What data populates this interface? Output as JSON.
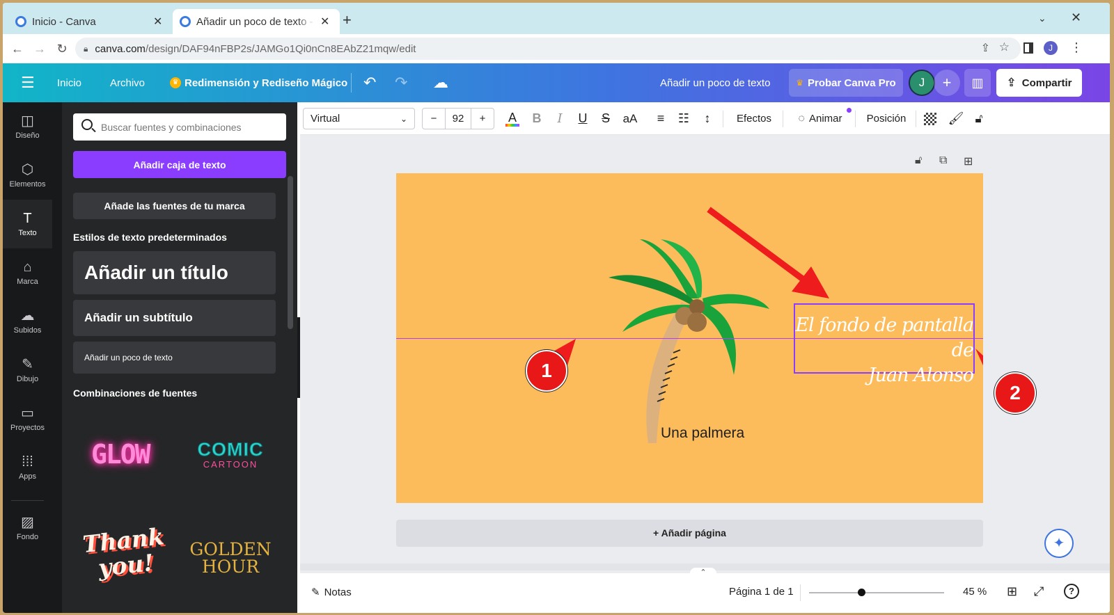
{
  "browser": {
    "tabs": [
      {
        "title": "Inicio - Canva",
        "active": false
      },
      {
        "title": "Añadir un poco de texto -",
        "active": true
      }
    ],
    "new_tab": "+",
    "url_domain": "canva.com",
    "url_path": "/design/DAF94nFBP2s/JAMGo1Qi0nCn8EAbZ21mqw/edit",
    "profile_initial": "J"
  },
  "header": {
    "inicio": "Inicio",
    "archivo": "Archivo",
    "magic": "Redimensión y Rediseño Mágico",
    "doc_title": "Añadir un poco de texto",
    "pro": "Probar Canva Pro",
    "avatar": "J",
    "share": "Compartir"
  },
  "rail": [
    {
      "label": "Diseño",
      "icon": "layout-icon"
    },
    {
      "label": "Elementos",
      "icon": "elements-icon"
    },
    {
      "label": "Texto",
      "icon": "text-icon"
    },
    {
      "label": "Marca",
      "icon": "brand-icon"
    },
    {
      "label": "Subidos",
      "icon": "upload-icon"
    },
    {
      "label": "Dibujo",
      "icon": "draw-icon"
    },
    {
      "label": "Proyectos",
      "icon": "folder-icon"
    },
    {
      "label": "Apps",
      "icon": "apps-icon"
    },
    {
      "label": "Fondo",
      "icon": "background-icon"
    }
  ],
  "panel": {
    "search_placeholder": "Buscar fuentes y combinaciones",
    "add_textbox": "Añadir caja de texto",
    "brand_fonts": "Añade las fuentes de tu marca",
    "default_styles": "Estilos de texto predeterminados",
    "add_title": "Añadir un título",
    "add_subtitle": "Añadir un subtítulo",
    "add_body": "Añadir un poco de texto",
    "combos": "Combinaciones de fuentes",
    "combo_glow": "GLOW",
    "combo_comic": "COMIC",
    "combo_cartoon": "CARTOON",
    "combo_thank": "Thank you!",
    "combo_golden": "GOLDEN HOUR"
  },
  "toolbar": {
    "font": "Virtual",
    "minus": "−",
    "size": "92",
    "plus": "+",
    "bold": "B",
    "italic": "I",
    "underline": "U",
    "strike": "S",
    "case": "aA",
    "effects": "Efectos",
    "animate": "Animar",
    "position": "Posición"
  },
  "canvas": {
    "script_line1": "El fondo de pantalla de",
    "script_line2": "Juan Alonso",
    "palm_caption": "Una palmera",
    "marker1": "1",
    "marker2": "2",
    "add_page": "+ Añadir página",
    "page_bg": "#fdbc5c",
    "selection_color": "#8b3dff",
    "arrow_color": "#ee1c1c"
  },
  "bottom": {
    "notes": "Notas",
    "page_indicator": "Página 1 de 1",
    "zoom": "45 %",
    "zoom_level": 0.45
  }
}
